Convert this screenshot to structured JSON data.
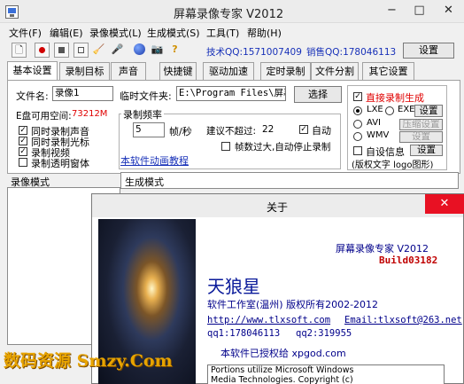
{
  "window": {
    "title": "屏幕录像专家 V2012",
    "controls": {
      "minimize": "−",
      "maximize": "□",
      "close": "✕"
    }
  },
  "menu": [
    "文件(F)",
    "编辑(E)",
    "录像模式(L)",
    "生成模式(S)",
    "工具(T)",
    "帮助(H)"
  ],
  "toolbar": {
    "tech_qq": "技术QQ:1571007409",
    "sales_qq": "销售QQ:178046113",
    "settings_label": "设置",
    "icons": [
      "new-file-icon",
      "record-icon",
      "stop-icon",
      "pause-icon",
      "broom-icon",
      "microphone-icon",
      "globe-icon",
      "camera-icon",
      "help-icon"
    ]
  },
  "tabs": [
    "基本设置",
    "录制目标",
    "声音",
    "快捷键",
    "驱动加速",
    "定时录制",
    "文件分割",
    "其它设置"
  ],
  "basic": {
    "filename_label": "文件名:",
    "filename_value": "录像1",
    "temp_folder_label": "临时文件夹:",
    "temp_folder_value": "E:\\Program Files\\屏幕录",
    "browse_button": "选择",
    "disk_space_label": "E盘可用空间:",
    "disk_space_value": "73212M",
    "checks": [
      {
        "label": "同时录制声音",
        "checked": true
      },
      {
        "label": "同时录制光标",
        "checked": true
      },
      {
        "label": "录制视频",
        "checked": true
      },
      {
        "label": "录制透明窗体",
        "checked": false
      }
    ],
    "fps_group": "录制频率",
    "fps_value": "5",
    "fps_unit": "帧/秒",
    "suggest_label": "建议不超过:",
    "suggest_value": "22",
    "auto_label": "自动",
    "auto_checked": true,
    "auto_stop_label": "帧数过大,自动停止录制",
    "auto_stop_checked": false,
    "tutorial_link": "本软件动画教程"
  },
  "right_panel": {
    "direct_gen_label": "直接录制生成",
    "direct_gen_checked": true,
    "formats": [
      {
        "label": "LXE",
        "selected": true
      },
      {
        "label": "EXE",
        "selected": false
      },
      {
        "label": "AVI",
        "selected": false
      },
      {
        "label": "WMV",
        "selected": false
      }
    ],
    "settings_button": "设置",
    "compress_settings_button": "压缩设置",
    "settings_button_2": "设置",
    "custom_info_label": "自设信息",
    "custom_info_checked": false,
    "custom_info_button": "设置",
    "custom_info_sub": "(版权文字 logo图形)"
  },
  "lists": {
    "record_mode_label": "录像模式",
    "gen_mode_label": "生成模式"
  },
  "about": {
    "title": "关于",
    "close": "✕",
    "product": "屏幕录像专家  V2012",
    "build": "Build03182",
    "brand": "天狼星",
    "studio": "软件工作室(温州)  版权所有2002-2012",
    "website": "http://www.tlxsoft.com",
    "email": "Email:tlxsoft@263.net",
    "qq1": "qq1:178046113",
    "qq2": "qq2:319955",
    "licensed": "本软件已授权给 xpgod.com",
    "notice_line1": "Portions utilize Microsoft Windows",
    "notice_line2": "Media Technologies.  Copyright (c)"
  },
  "watermark": "数码资源 Smzy.Com",
  "colors": {
    "red_text": "#e00000",
    "link_blue": "#1730b8",
    "build_red": "#c00000"
  }
}
